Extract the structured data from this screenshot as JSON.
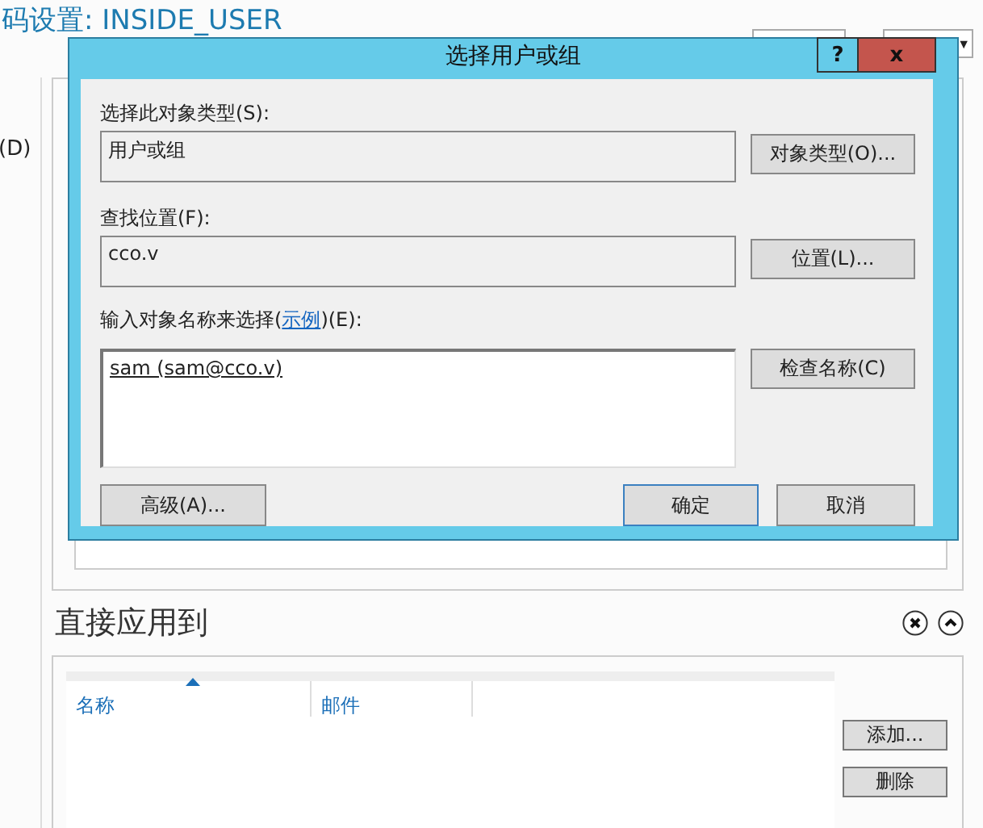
{
  "page": {
    "title": "码设置: INSIDE_USER",
    "left_label": "(D)",
    "dropdown": {
      "caret": "▼"
    }
  },
  "applies_to": {
    "title": "直接应用到",
    "columns": [
      {
        "label": "名称",
        "sorted": true
      },
      {
        "label": "邮件",
        "sorted": false
      }
    ],
    "buttons": [
      "添加...",
      "删除"
    ]
  },
  "dialog": {
    "title": "选择用户或组",
    "help": "?",
    "close": "x",
    "object_type": {
      "label": "选择此对象类型(S):",
      "value": "用户或组",
      "button": "对象类型(O)..."
    },
    "location": {
      "label": "查找位置(F):",
      "value": "cco.v",
      "button": "位置(L)..."
    },
    "names": {
      "label_before": "输入对象名称来选择(",
      "link": "示例",
      "label_after": ")(E):",
      "value": "sam (sam@cco.v)",
      "button": "检查名称(C)"
    },
    "buttons": [
      {
        "label": "高级(A)...",
        "kind": "left",
        "default": false
      },
      {
        "label": "确定",
        "kind": "right",
        "default": true
      },
      {
        "label": "取消",
        "kind": "right",
        "default": false
      }
    ]
  }
}
